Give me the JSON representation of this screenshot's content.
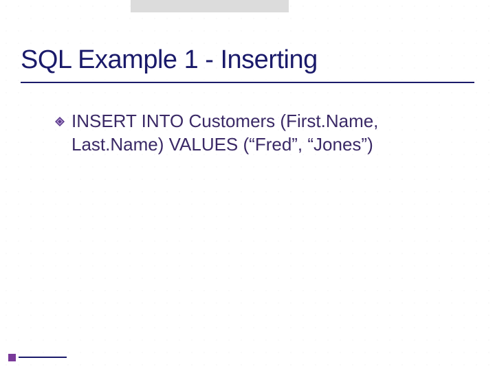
{
  "slide": {
    "title": "SQL Example 1 - Inserting",
    "bullets": [
      "INSERT INTO Customers (First.Name, Last.Name) VALUES (“Fred”, “Jones”)"
    ]
  },
  "colors": {
    "title": "#1a1a6a",
    "body": "#3a2966",
    "accent_square": "#7a3a9a",
    "topbar": "#dcdcdc"
  }
}
